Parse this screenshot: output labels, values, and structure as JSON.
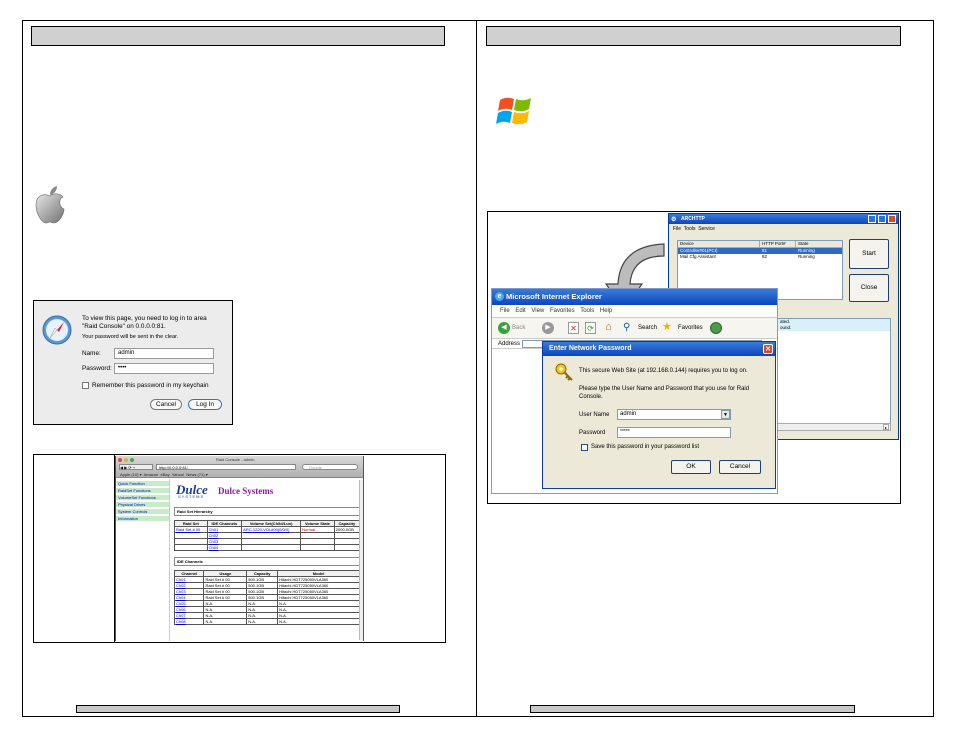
{
  "mac_dialog": {
    "message_line1": "To view this page, you need to log in to area",
    "message_line2": "\"Raid Console\" on 0.0.0.0:81.",
    "note": "Your password will be sent in the clear.",
    "name_label": "Name:",
    "name_value": "admin",
    "password_label": "Password:",
    "password_value": "••••",
    "remember_label": "Remember this password in my keychain",
    "cancel_label": "Cancel",
    "login_label": "Log In"
  },
  "safari": {
    "title": "Raid Console - admin",
    "url": "http://0.0.0.0:81/",
    "search_placeholder": "Google",
    "bookmarks": [
      "Apple (10) ▾",
      "Amazon",
      "eBay",
      "Yahoo!",
      "News (71) ▾"
    ],
    "sidebar": [
      "Quick Function",
      "RaidSet Functions",
      "VolumeSet Functions",
      "Physical Drives",
      "System Controls",
      "Information"
    ],
    "brand_logo": "Dulce",
    "brand_sub": "SYSTEMS",
    "brand_name": "Dulce Systems",
    "raid_section": "Raid Set Hierarchy",
    "raid_headers": [
      "Raid Set",
      "IDE Channels",
      "Volume Set(Ch/Id/Lun)",
      "Volume State",
      "Capacity"
    ],
    "raid_rows": [
      [
        "Raid Set # 00",
        "Ch01",
        "ARC-1220-VOL#00(0/0/0)",
        "Normal",
        "2000.0GB"
      ],
      [
        "",
        "Ch02",
        "",
        "",
        ""
      ],
      [
        "",
        "Ch03",
        "",
        "",
        ""
      ],
      [
        "",
        "Ch04",
        "",
        "",
        ""
      ]
    ],
    "ide_section": "IDE Channels",
    "ide_headers": [
      "Channel",
      "Usage",
      "Capacity",
      "Model"
    ],
    "ide_rows": [
      [
        "Ch01",
        "Raid Set # 00",
        "500.1GB",
        "Hitachi HDT725050VLA360"
      ],
      [
        "Ch02",
        "Raid Set # 00",
        "500.1GB",
        "Hitachi HDT725050VLA360"
      ],
      [
        "Ch03",
        "Raid Set # 00",
        "500.1GB",
        "Hitachi HDT725050VLA360"
      ],
      [
        "Ch04",
        "Raid Set # 00",
        "500.1GB",
        "Hitachi HDT725050VLA360"
      ],
      [
        "Ch05",
        "N.A.",
        "N.A.",
        "N.A."
      ],
      [
        "Ch06",
        "N.A.",
        "N.A.",
        "N.A."
      ],
      [
        "Ch07",
        "N.A.",
        "N.A.",
        "N.A."
      ],
      [
        "Ch08",
        "N.A.",
        "N.A.",
        "N.A."
      ]
    ]
  },
  "archttp": {
    "title": "ARCHTTP",
    "menu": [
      "File",
      "Tools",
      "Service"
    ],
    "headers": [
      "Device",
      "HTTP Port#",
      "State"
    ],
    "rows": [
      [
        "Controller#01(PCI)",
        "81",
        "Running"
      ],
      [
        "Mail Cfg Assistant",
        "82",
        "Running"
      ]
    ],
    "start_label": "Start",
    "close_label": "Close",
    "log_line1": "ated.",
    "log_line2": "ound."
  },
  "ie": {
    "title": "Microsoft Internet Explorer",
    "menu": [
      "File",
      "Edit",
      "View",
      "Favorites",
      "Tools",
      "Help"
    ],
    "back_label": "Back",
    "search_label": "Search",
    "favorites_label": "Favorites",
    "address_label": "Address"
  },
  "net_password": {
    "title": "Enter Network Password",
    "message": "This secure Web Site (at 192.168.0.144) requires you to log on.",
    "instruction_line1": "Please type the User Name and Password that you use for Raid",
    "instruction_line2": "Console.",
    "username_label": "User Name",
    "username_value": "admin",
    "password_label": "Password",
    "password_value": "*****",
    "save_label": "Save this password in your password list",
    "ok_label": "OK",
    "cancel_label": "Cancel"
  },
  "colors": {
    "header_bar": "#d0d0d0",
    "xp_title": "#0a46c0",
    "ie_selection": "#316ac5",
    "link_blue": "#0000cc",
    "normal_red": "#cc0000",
    "dulce_purple": "#8b1a9c"
  }
}
